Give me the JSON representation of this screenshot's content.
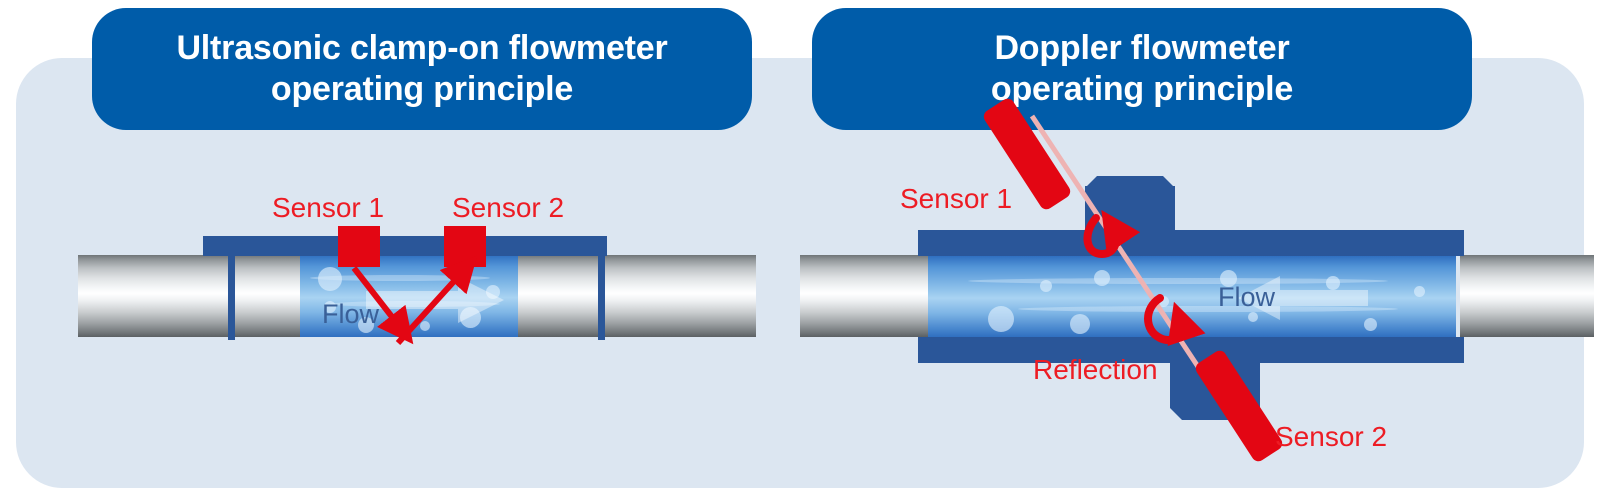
{
  "colors": {
    "page_background": "#ffffff",
    "card_background": "#dce6f1",
    "header_blue": "#005ca9",
    "structure_blue": "#2a5699",
    "sensor_red": "#e30613",
    "label_red": "#ed1c24",
    "flow_label_blue": "#3a6098",
    "beam_pink": "#eeb3b3"
  },
  "panels": [
    {
      "title": "Ultrasonic clamp-on flowmeter\noperating principle",
      "title_line1": "Ultrasonic clamp-on flowmeter",
      "title_line2": "operating principle",
      "labels": {
        "sensor1": "Sensor 1",
        "sensor2": "Sensor 2",
        "flow": "Flow"
      },
      "flow_direction": "right",
      "signal_path": "V-path reflection between two clamp-on sensors"
    },
    {
      "title": "Doppler flowmeter\noperating principle",
      "title_line1": "Doppler flowmeter",
      "title_line2": "operating principle",
      "labels": {
        "sensor1": "Sensor 1",
        "sensor2": "Sensor 2",
        "flow": "Flow",
        "reflection": "Reflection"
      },
      "flow_direction": "left",
      "signal_path": "Diagonal beam through liquid with reflection turn-arrows"
    }
  ]
}
